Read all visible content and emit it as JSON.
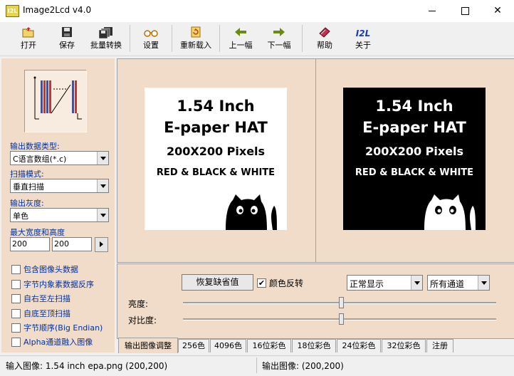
{
  "window": {
    "icon_text": "I2L",
    "title": "Image2Lcd v4.0"
  },
  "toolbar": {
    "open": "打开",
    "save": "保存",
    "batch": "批量转换",
    "settings": "设置",
    "reload": "重新载入",
    "prev": "上一幅",
    "next": "下一幅",
    "help": "帮助",
    "about": "关于",
    "about_icon_text": "I2L"
  },
  "left": {
    "output_type_label": "输出数据类型:",
    "output_type_value": "C语言数组(*.c)",
    "scan_mode_label": "扫描模式:",
    "scan_mode_value": "垂直扫描",
    "gray_label": "输出灰度:",
    "gray_value": "单色",
    "max_size_label": "最大宽度和高度",
    "max_width": "200",
    "max_height": "200",
    "checkboxes": [
      {
        "label": "包含图像头数据",
        "checked": false
      },
      {
        "label": "字节内象素数据反序",
        "checked": false
      },
      {
        "label": "自右至左扫描",
        "checked": false
      },
      {
        "label": "自底至顶扫描",
        "checked": false
      },
      {
        "label": "字节顺序(Big Endian)",
        "checked": false
      },
      {
        "label": "Alpha通道融入图像",
        "checked": false
      }
    ]
  },
  "preview": {
    "line1": "1.54 Inch",
    "line2": "E-paper HAT",
    "line3": "200X200 Pixels",
    "line4": "RED & BLACK & WHITE"
  },
  "adjust": {
    "restore_button": "恢复缺省值",
    "invert_label": "颜色反转",
    "invert_checked": true,
    "display_mode": "正常显示",
    "channel": "所有通道",
    "brightness_label": "亮度:",
    "contrast_label": "对比度:",
    "brightness": 0.5,
    "contrast": 0.5
  },
  "tabs": [
    "输出图像调整",
    "256色",
    "4096色",
    "16位彩色",
    "18位彩色",
    "24位彩色",
    "32位彩色",
    "注册"
  ],
  "status": {
    "input": "输入图像: 1.54 inch epa.png (200,200)",
    "output": "输出图像: (200,200)"
  }
}
